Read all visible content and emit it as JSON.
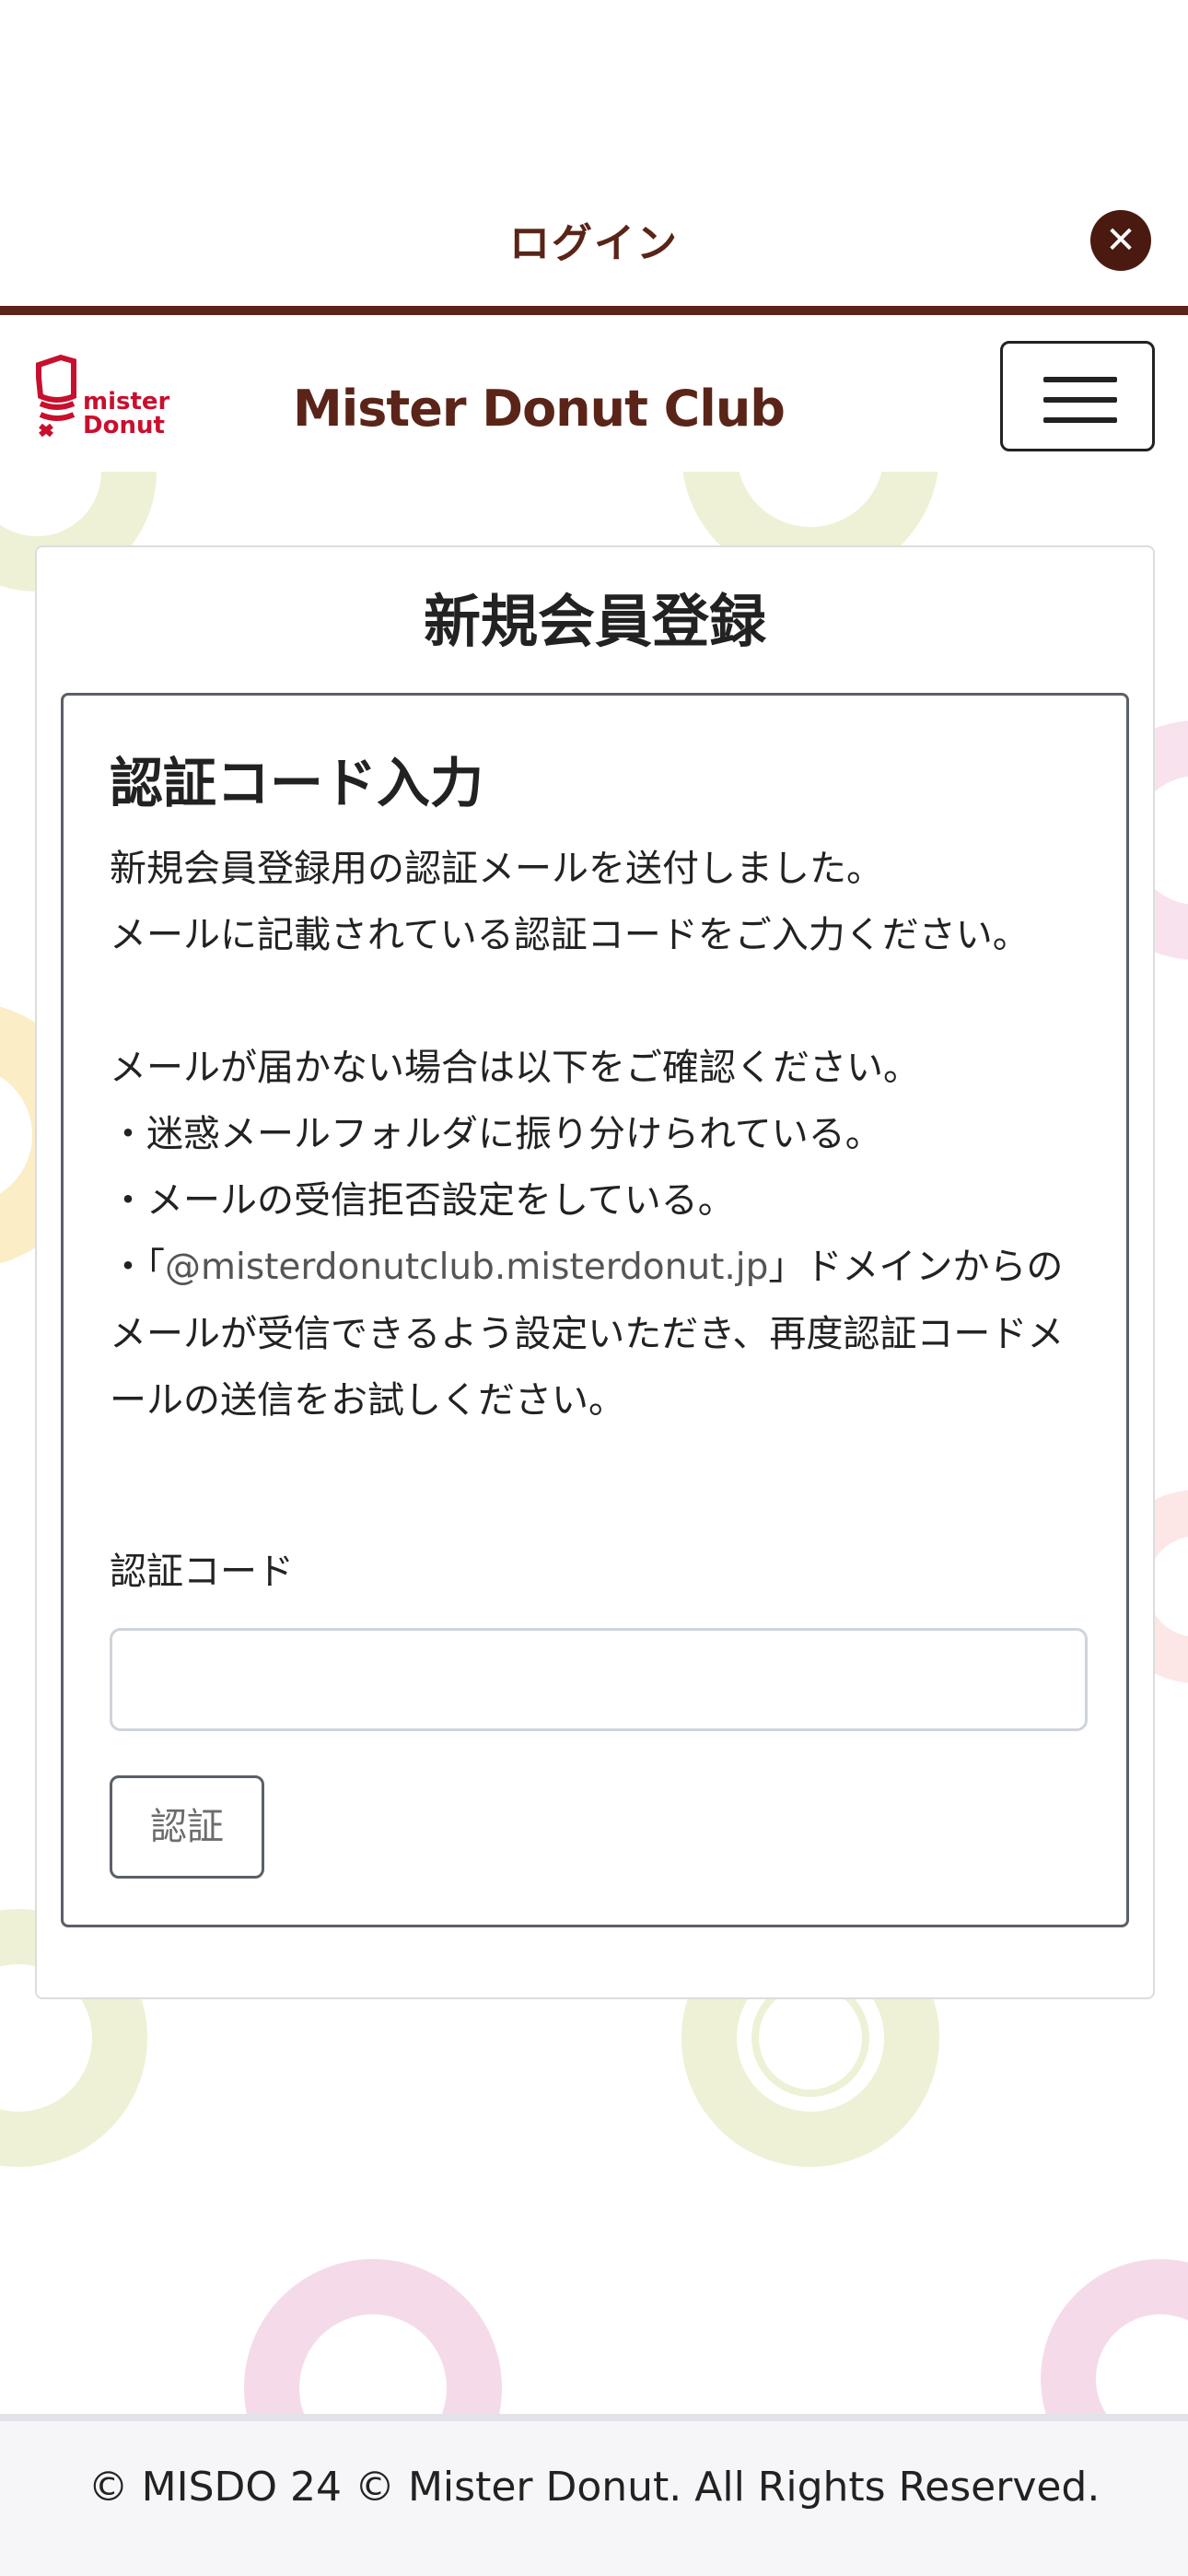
{
  "modal": {
    "title": "ログイン",
    "close_icon": "close-icon"
  },
  "header": {
    "logo_text": "mister Donut",
    "club_title": "Mister Donut Club",
    "menu_icon": "hamburger-menu-icon"
  },
  "card": {
    "title": "新規会員登録",
    "panel": {
      "heading": "認証コード入力",
      "line1": "新規会員登録用の認証メールを送付しました。",
      "line2": "メールに記載されている認証コードをご入力ください。",
      "line3": "メールが届かない場合は以下をご確認ください。",
      "bullet1": "・迷惑メールフォルダに振り分けられている。",
      "bullet2": "・メールの受信拒否設定をしている。",
      "bullet3_prefix": "・「",
      "bullet3_domain": "@misterdonutclub.misterdonut.jp",
      "bullet3_suffix": "」ドメインからのメールが受信できるよう設定いただき、再度認証コードメールの送信をお試しください。",
      "field_label": "認証コード",
      "field_value": "",
      "submit_label": "認証"
    }
  },
  "footer": {
    "copyright": "© MISDO 24 © Mister Donut. All Rights Reserved."
  },
  "colors": {
    "brand_brown": "#5a2418",
    "brand_red": "#c8102e"
  }
}
